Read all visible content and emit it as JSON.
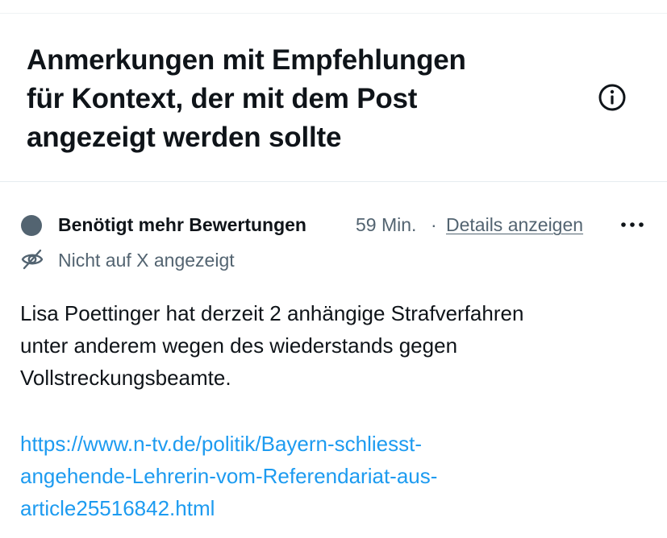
{
  "header": {
    "title_lines": [
      "Anmerkungen mit Empfehlungen",
      "für Kontext, der mit dem Post",
      "angezeigt werden sollte"
    ],
    "info_icon": "info-circle-icon"
  },
  "note": {
    "status_label": "Benötigt mehr Bewertungen",
    "timestamp": "59 Min.",
    "separator": "·",
    "details_link": "Details anzeigen",
    "more_icon": "more-horizontal-icon",
    "visibility_icon": "eye-slash-icon",
    "visibility_text": "Nicht auf X angezeigt",
    "body_lines": [
      "Lisa Poettinger hat derzeit 2 anhängige Strafverfahren",
      "unter anderem wegen des wiederstands gegen",
      "Vollstreckungsbeamte."
    ],
    "link_lines": [
      "https://www.n-tv.de/politik/Bayern-schliesst-",
      "angehende-Lehrerin-vom-Referendariat-aus-",
      "article25516842.html"
    ]
  },
  "colors": {
    "text_primary": "#0f1419",
    "text_secondary": "#536471",
    "link": "#1d9bf0",
    "divider": "#e6ecf0"
  }
}
